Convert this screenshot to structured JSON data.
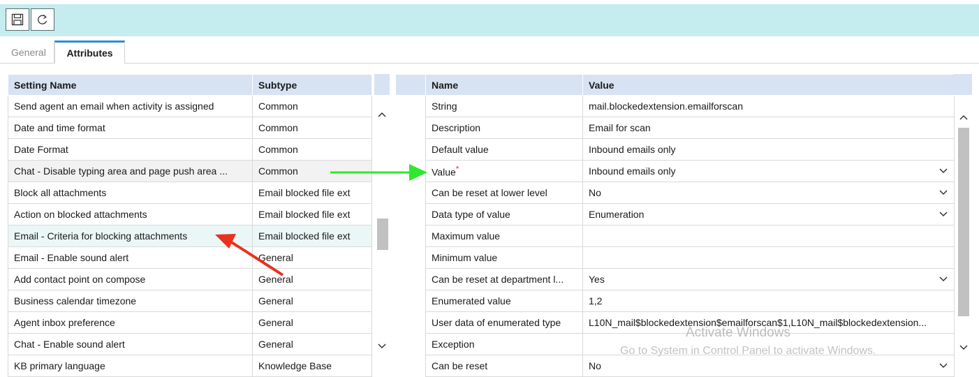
{
  "toolbar": {
    "buttons": [
      {
        "icon": "save-icon"
      },
      {
        "icon": "refresh-icon"
      }
    ]
  },
  "tabs": [
    {
      "label": "General",
      "active": false
    },
    {
      "label": "Attributes",
      "active": true
    }
  ],
  "settings_grid": {
    "columns": [
      "Setting Name",
      "Subtype"
    ],
    "rows": [
      [
        "Send agent an email when activity is assigned",
        "Common"
      ],
      [
        "Date and time format",
        "Common"
      ],
      [
        "Date Format",
        "Common"
      ],
      [
        "Chat - Disable typing area and page push area ...",
        "Common"
      ],
      [
        "Block all attachments",
        "Email blocked file ext"
      ],
      [
        "Action on blocked attachments",
        "Email blocked file ext"
      ],
      [
        "Email - Criteria for blocking attachments",
        "Email blocked file ext"
      ],
      [
        "Email - Enable sound alert",
        "General"
      ],
      [
        "Add contact point on compose",
        "General"
      ],
      [
        "Business calendar timezone",
        "General"
      ],
      [
        "Agent inbox preference",
        "General"
      ],
      [
        "Chat - Enable sound alert",
        "General"
      ],
      [
        "KB primary language",
        "Knowledge Base"
      ]
    ]
  },
  "attributes_grid": {
    "columns": [
      "Name",
      "Value"
    ],
    "rows": [
      {
        "name": "String",
        "value": "mail.blockedextension.emailforscan",
        "dropdown": false
      },
      {
        "name": "Description",
        "value": "Email for scan",
        "dropdown": false
      },
      {
        "name": "Default value",
        "value": "Inbound emails only",
        "dropdown": false
      },
      {
        "name": "Value",
        "value": "Inbound emails only",
        "dropdown": true,
        "required": "*"
      },
      {
        "name": "Can be reset at lower level",
        "value": "No",
        "dropdown": true
      },
      {
        "name": "Data type of value",
        "value": "Enumeration",
        "dropdown": true
      },
      {
        "name": "Maximum value",
        "value": "",
        "dropdown": false
      },
      {
        "name": "Minimum value",
        "value": "",
        "dropdown": false
      },
      {
        "name": "Can be reset at department l...",
        "value": "Yes",
        "dropdown": true
      },
      {
        "name": "Enumerated value",
        "value": "1,2",
        "dropdown": false
      },
      {
        "name": "User data of enumerated type",
        "value": "L10N_mail$blockedextension$emailforscan$1,L10N_mail$blockedextension...",
        "dropdown": false
      },
      {
        "name": "Exception",
        "value": "",
        "dropdown": false
      },
      {
        "name": "Can be reset",
        "value": "No",
        "dropdown": true
      }
    ]
  },
  "watermark": {
    "line1": "Activate Windows",
    "line2": "Go to System in Control Panel to activate Windows."
  },
  "annotations": {
    "green_arrow_color": "#2ee82e",
    "red_arrow_color": "#e8321e"
  }
}
